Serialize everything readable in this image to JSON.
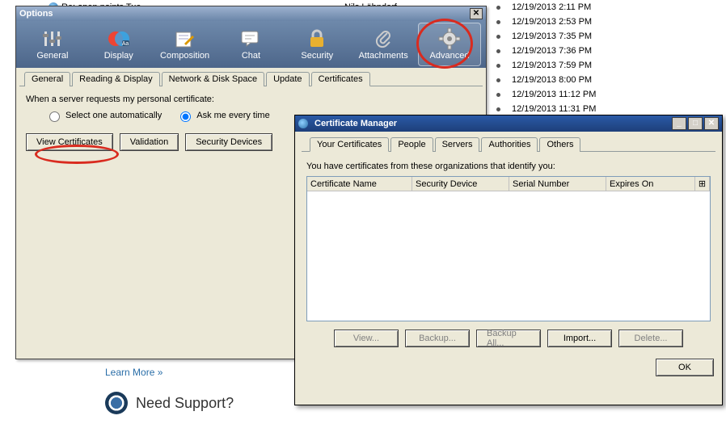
{
  "mail": {
    "subject_title": "Re: open points Tue",
    "sender": "Nils Löhndorf",
    "dates": [
      "12/19/2013 2:11 PM",
      "12/19/2013 2:53 PM",
      "12/19/2013 7:35 PM",
      "12/19/2013 7:36 PM",
      "12/19/2013 7:59 PM",
      "12/19/2013 8:00 PM",
      "12/19/2013 11:12 PM",
      "12/19/2013 11:31 PM"
    ]
  },
  "learn_more": "Learn More »",
  "support_text": "Need Support?",
  "options": {
    "title": "Options",
    "toolbar": [
      {
        "label": "General"
      },
      {
        "label": "Display"
      },
      {
        "label": "Composition"
      },
      {
        "label": "Chat"
      },
      {
        "label": "Security"
      },
      {
        "label": "Attachments"
      },
      {
        "label": "Advanced"
      }
    ],
    "subtabs": [
      {
        "label": "General"
      },
      {
        "label": "Reading & Display"
      },
      {
        "label": "Network & Disk Space"
      },
      {
        "label": "Update"
      },
      {
        "label": "Certificates"
      }
    ],
    "body_text": "When a server requests my personal certificate:",
    "radio1": "Select one automatically",
    "radio2": "Ask me every time",
    "btn_view": "View Certificates",
    "btn_valid": "Validation",
    "btn_secdev": "Security Devices"
  },
  "cert": {
    "title": "Certificate Manager",
    "tabs": [
      {
        "label": "Your Certificates"
      },
      {
        "label": "People"
      },
      {
        "label": "Servers"
      },
      {
        "label": "Authorities"
      },
      {
        "label": "Others"
      }
    ],
    "desc": "You have certificates from these organizations that identify you:",
    "cols": {
      "name": "Certificate Name",
      "device": "Security Device",
      "serial": "Serial Number",
      "expires": "Expires On"
    },
    "btns": {
      "view": "View...",
      "backup": "Backup...",
      "backup_all": "Backup All...",
      "import": "Import...",
      "delete": "Delete..."
    },
    "ok": "OK"
  }
}
